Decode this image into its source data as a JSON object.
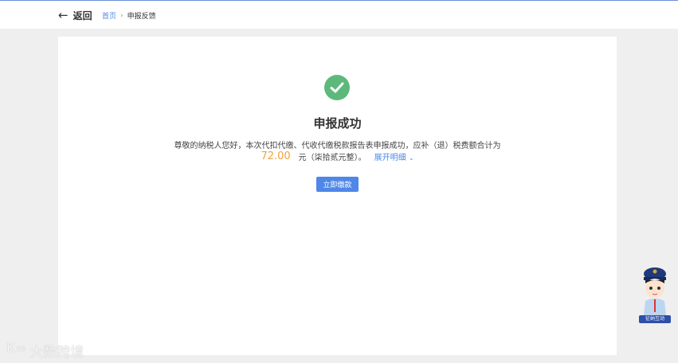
{
  "header": {
    "back_label": "返回",
    "breadcrumb": [
      "首页",
      "申报反馈"
    ]
  },
  "result": {
    "title": "申报成功",
    "message": "尊敬的纳税人您好，本次代扣代缴、代收代缴税款报告表申报成功，应补（退）税费额合计为",
    "amount": "72.00",
    "amount_words": "元（柒拾贰元整）。",
    "expand_label": "展开明细",
    "expand_icon": "chevron-down-icon",
    "pay_button": "立即缴款",
    "status_color": "#5cb97a",
    "amount_color": "#f0a23b"
  },
  "mascot": {
    "label": "征纳互动"
  },
  "watermark": {
    "text": "大数跨境"
  }
}
